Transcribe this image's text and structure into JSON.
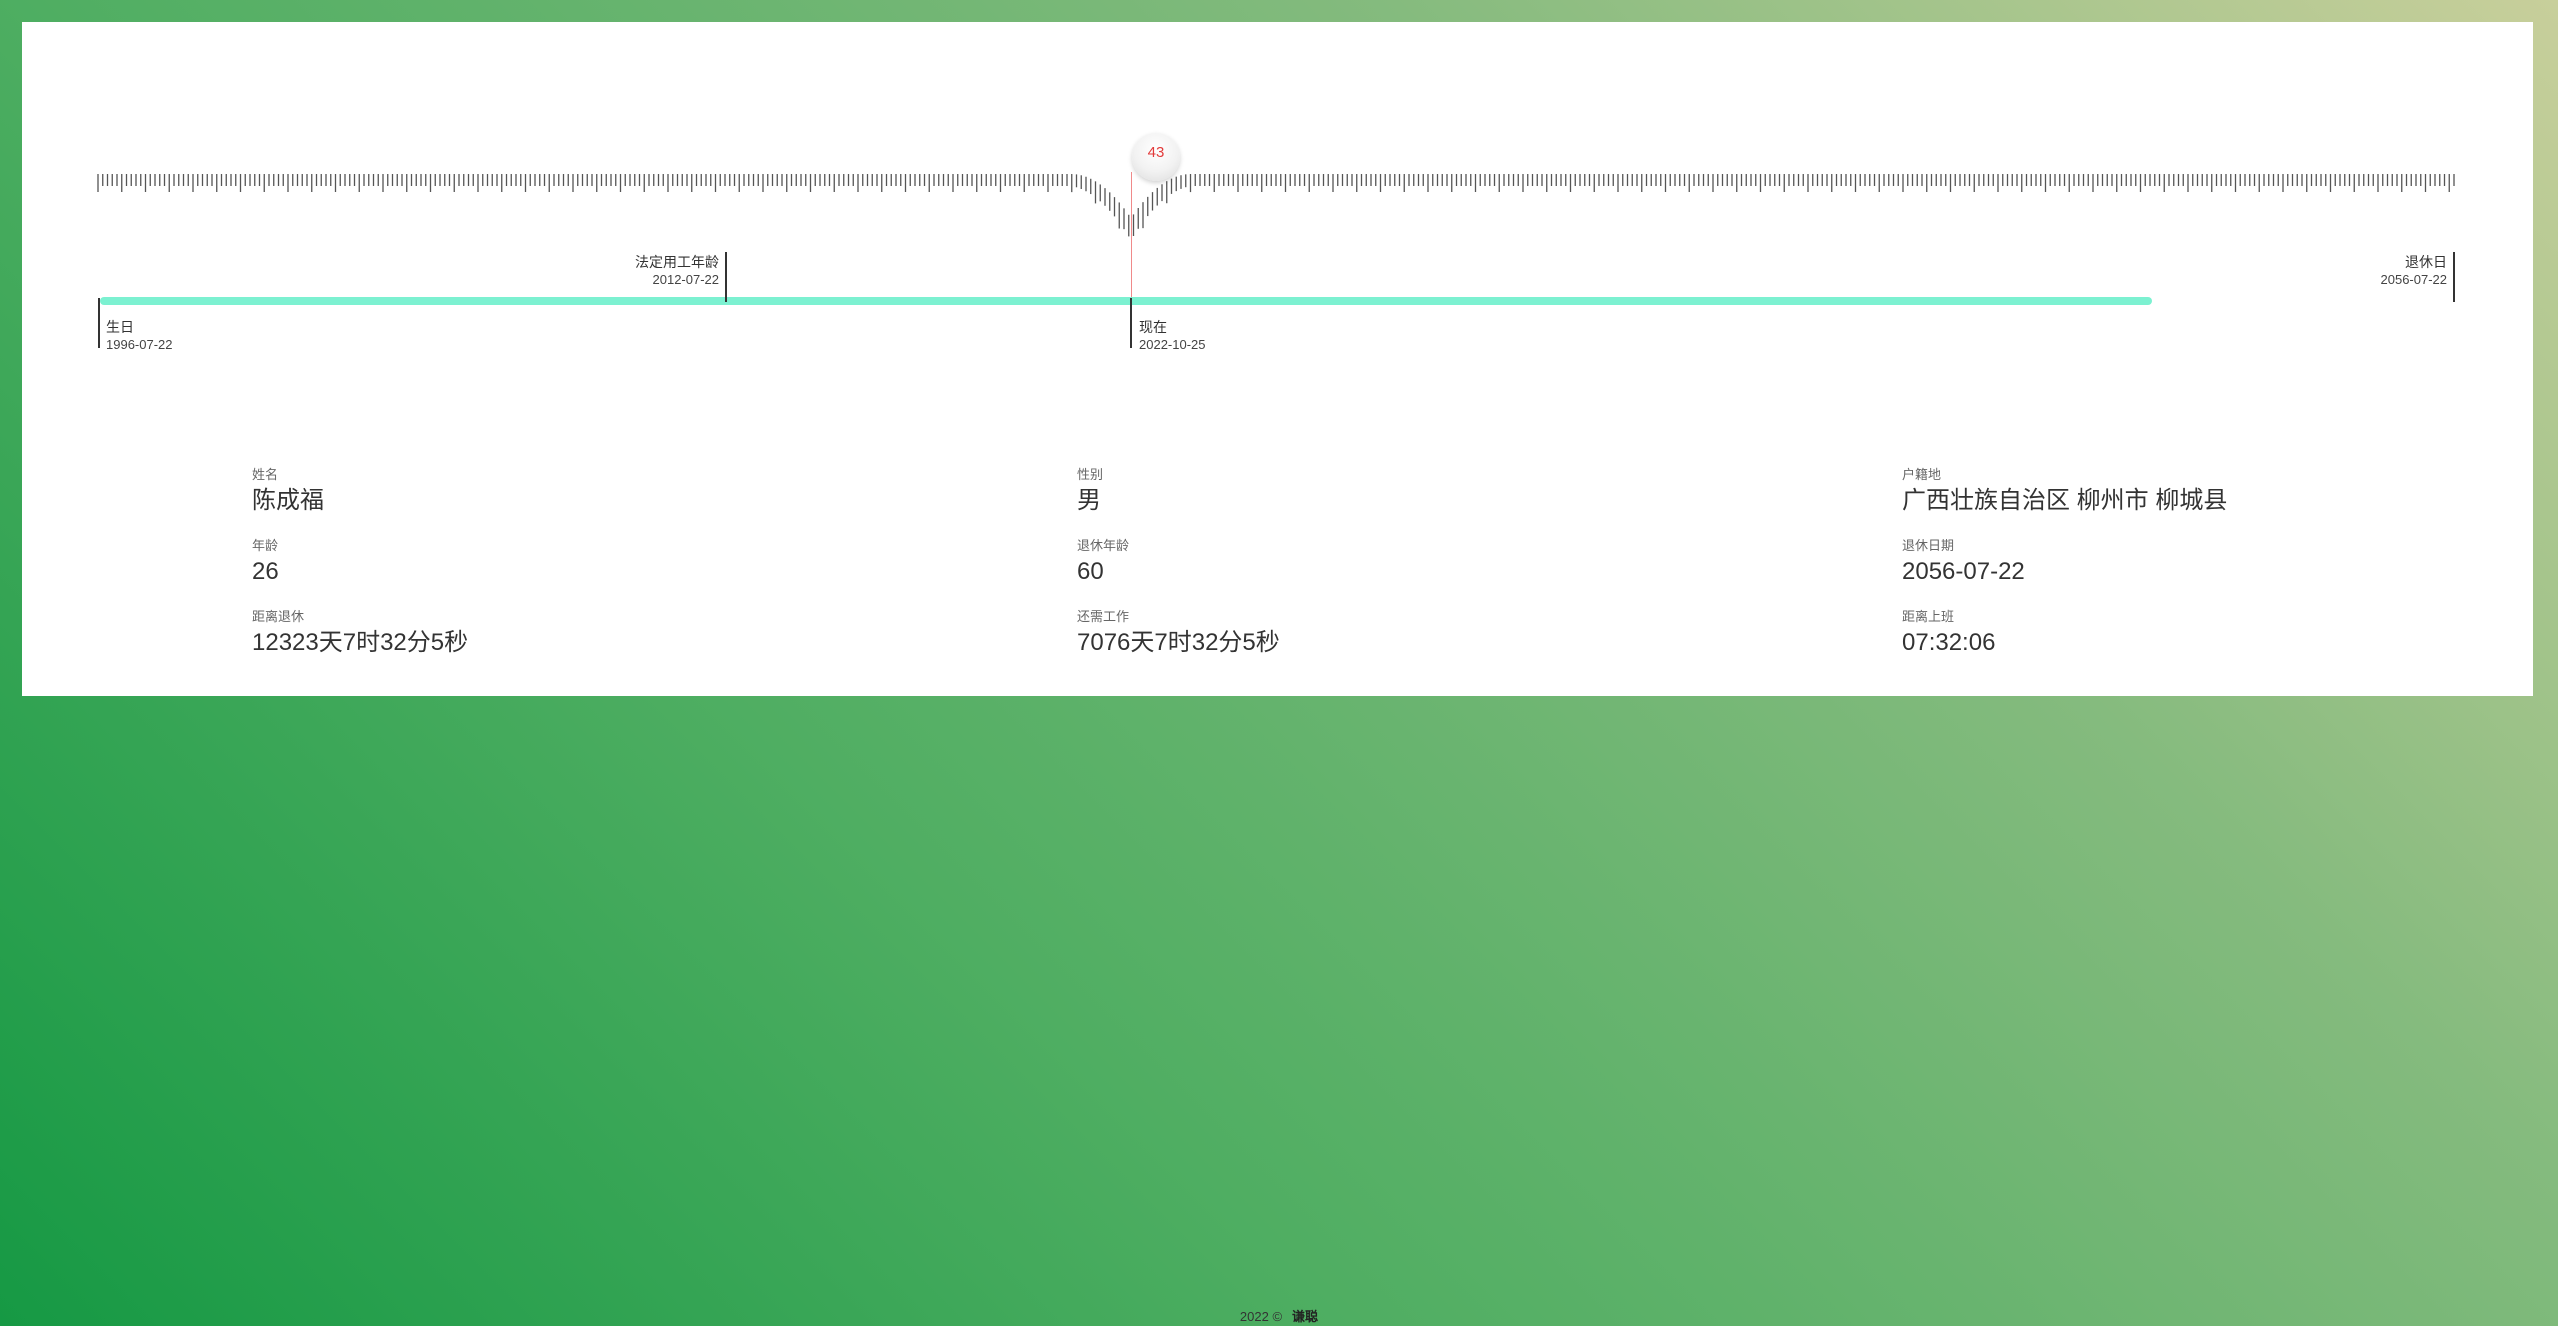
{
  "timeline": {
    "current_age": "43",
    "markers": {
      "birth": {
        "label": "生日",
        "date": "1996-07-22"
      },
      "legal_work_age": {
        "label": "法定用工年龄",
        "date": "2012-07-22"
      },
      "now": {
        "label": "现在",
        "date": "2022-10-25"
      },
      "retirement": {
        "label": "退休日",
        "date": "2056-07-22"
      }
    },
    "colors": {
      "track": "#7cf1d1",
      "now_line": "#f08a8a",
      "age_text": "#e23b3b"
    }
  },
  "info": {
    "name": {
      "label": "姓名",
      "value": "陈成福"
    },
    "gender": {
      "label": "性别",
      "value": "男"
    },
    "hometown": {
      "label": "户籍地",
      "value": "广西壮族自治区 柳州市 柳城县"
    },
    "age": {
      "label": "年龄",
      "value": "26"
    },
    "retire_age": {
      "label": "退休年龄",
      "value": "60"
    },
    "retire_date": {
      "label": "退休日期",
      "value": "2056-07-22"
    },
    "to_retire": {
      "label": "距离退休",
      "value": "12323天7时32分5秒"
    },
    "work_left": {
      "label": "还需工作",
      "value": "7076天7时32分5秒"
    },
    "to_work": {
      "label": "距离上班",
      "value": "07:32:06"
    }
  },
  "footer": {
    "copyright": "2022 ©",
    "brand": "谦聪"
  }
}
